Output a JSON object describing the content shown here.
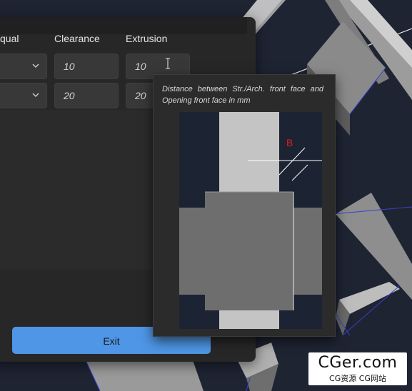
{
  "columns": {
    "equal_label": "qual",
    "clearance_label": "Clearance",
    "extrusion_label": "Extrusion"
  },
  "rows": [
    {
      "clearance": "10",
      "extrusion": "10"
    },
    {
      "clearance": "20",
      "extrusion": "20"
    }
  ],
  "exit_label": "Exit",
  "tooltip": {
    "text": "Distance between Str./Arch. front face and Opening front face in mm",
    "diagram_label": "B"
  },
  "watermark": {
    "main": "CGer.com",
    "sub": "CG资源 CG网站"
  },
  "colors": {
    "accent": "#4f96e6",
    "label_b": "#e02020",
    "panel": "#272727",
    "viewport": "#1f2433"
  }
}
